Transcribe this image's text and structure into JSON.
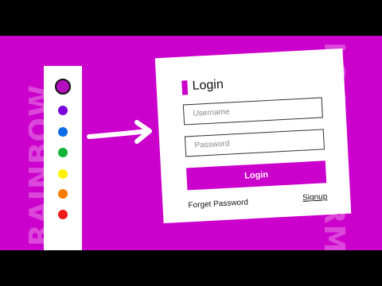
{
  "banner": {
    "left_text": "RAINBOW",
    "right_text": "LOGIN FORM"
  },
  "palette": {
    "colors": [
      "#b30fc0",
      "#7b00d9",
      "#0c6be8",
      "#13b43a",
      "#fff200",
      "#ff7b00",
      "#f01a1a"
    ],
    "selected_index": 0
  },
  "login": {
    "title": "Login",
    "username_placeholder": "Username",
    "password_placeholder": "Password",
    "login_button": "Login",
    "forget_password": "Forget Password",
    "signup": "Signup",
    "accent_color": "#cc00cc"
  }
}
